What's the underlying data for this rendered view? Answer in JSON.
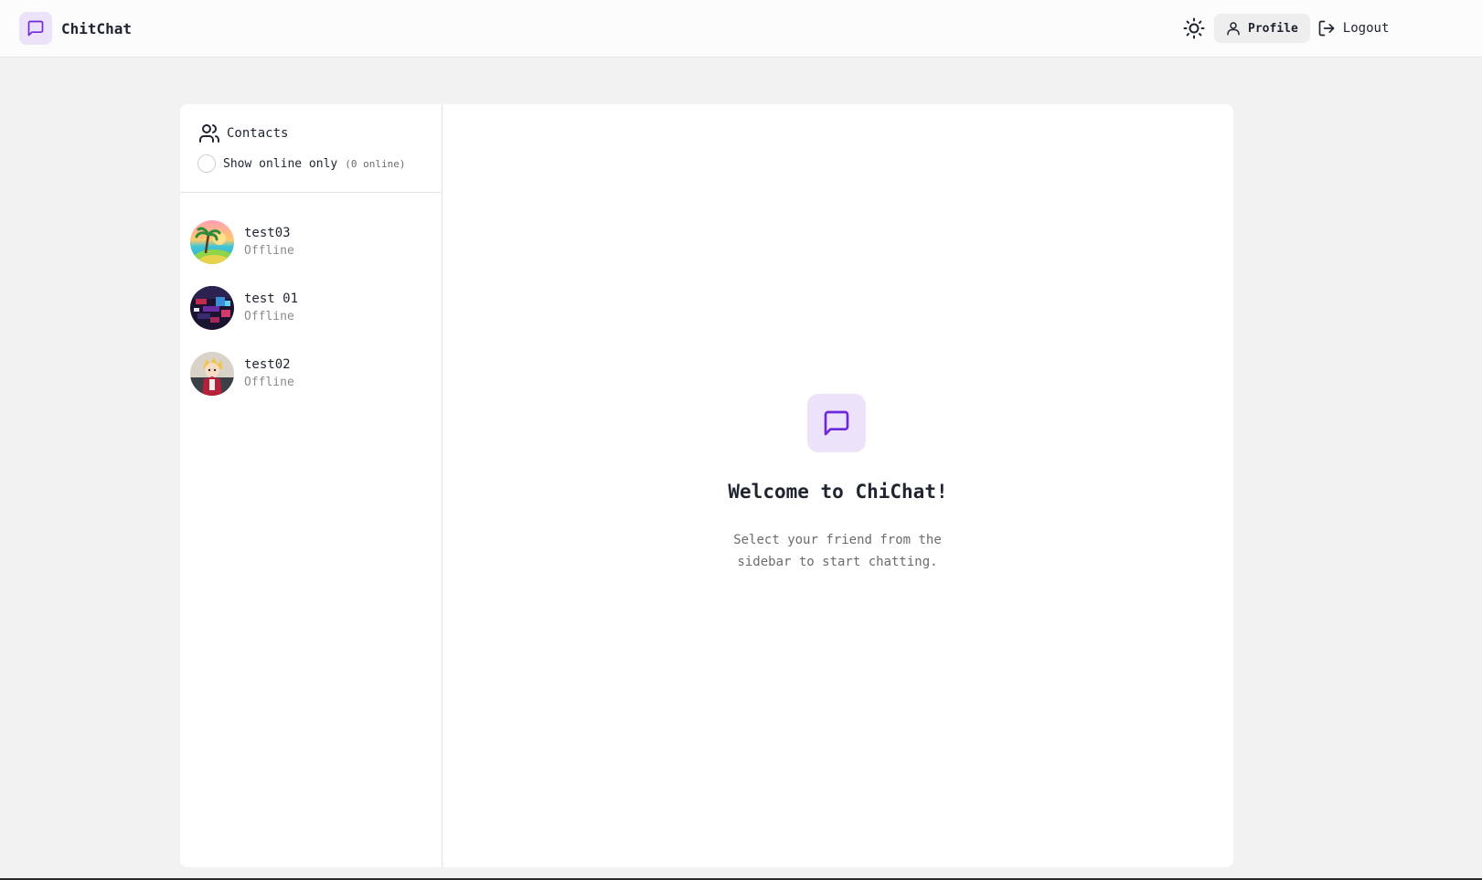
{
  "app": {
    "name": "ChitChat"
  },
  "header": {
    "theme_icon": "sun-icon",
    "profile_label": "Profile",
    "logout_label": "Logout"
  },
  "sidebar": {
    "title": "Contacts",
    "filter_label": "Show online only",
    "online_count": "(0 online)",
    "filter_checked": false,
    "contacts": [
      {
        "name": "test03",
        "status": "Offline",
        "avatar": "avatar-beach-palm"
      },
      {
        "name": "test 01",
        "status": "Offline",
        "avatar": "avatar-dark-pixel"
      },
      {
        "name": "test02",
        "status": "Offline",
        "avatar": "avatar-character"
      }
    ]
  },
  "welcome": {
    "title": "Welcome to ChiChat!",
    "subtitle": "Select your friend from the sidebar to start chatting.",
    "icon": "message-square-icon"
  },
  "colors": {
    "accent": "#6d28d9",
    "accent_bg": "#ece3fb",
    "page_bg": "#f2f2f2"
  }
}
